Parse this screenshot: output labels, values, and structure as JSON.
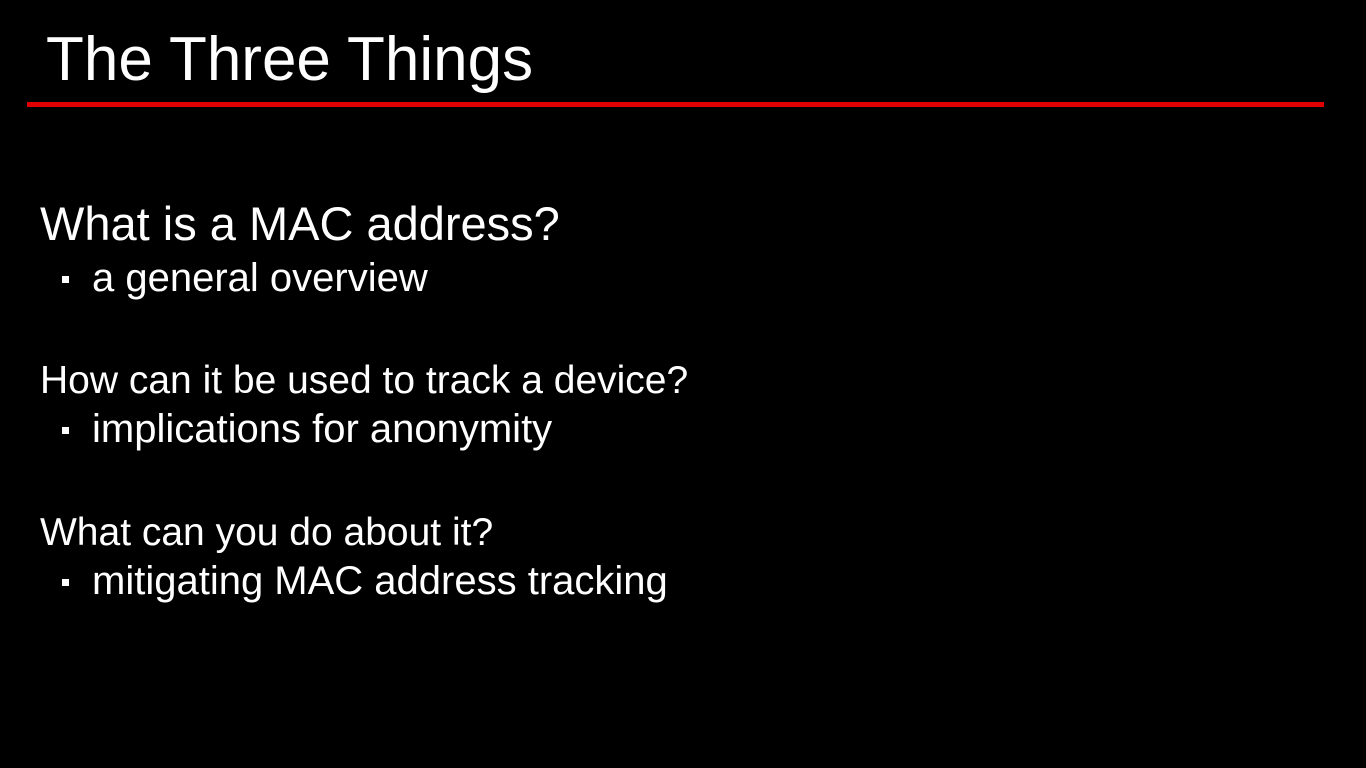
{
  "slide": {
    "title": "The Three Things",
    "accent_color": "#e00000",
    "background_color": "#000000",
    "text_color": "#ffffff",
    "sections": [
      {
        "heading": "What is a MAC address?",
        "bullet": "a general overview"
      },
      {
        "heading": "How can it be used to track a device?",
        "bullet": "implications for anonymity"
      },
      {
        "heading": "What can you do about it?",
        "bullet": "mitigating MAC address tracking"
      }
    ]
  }
}
